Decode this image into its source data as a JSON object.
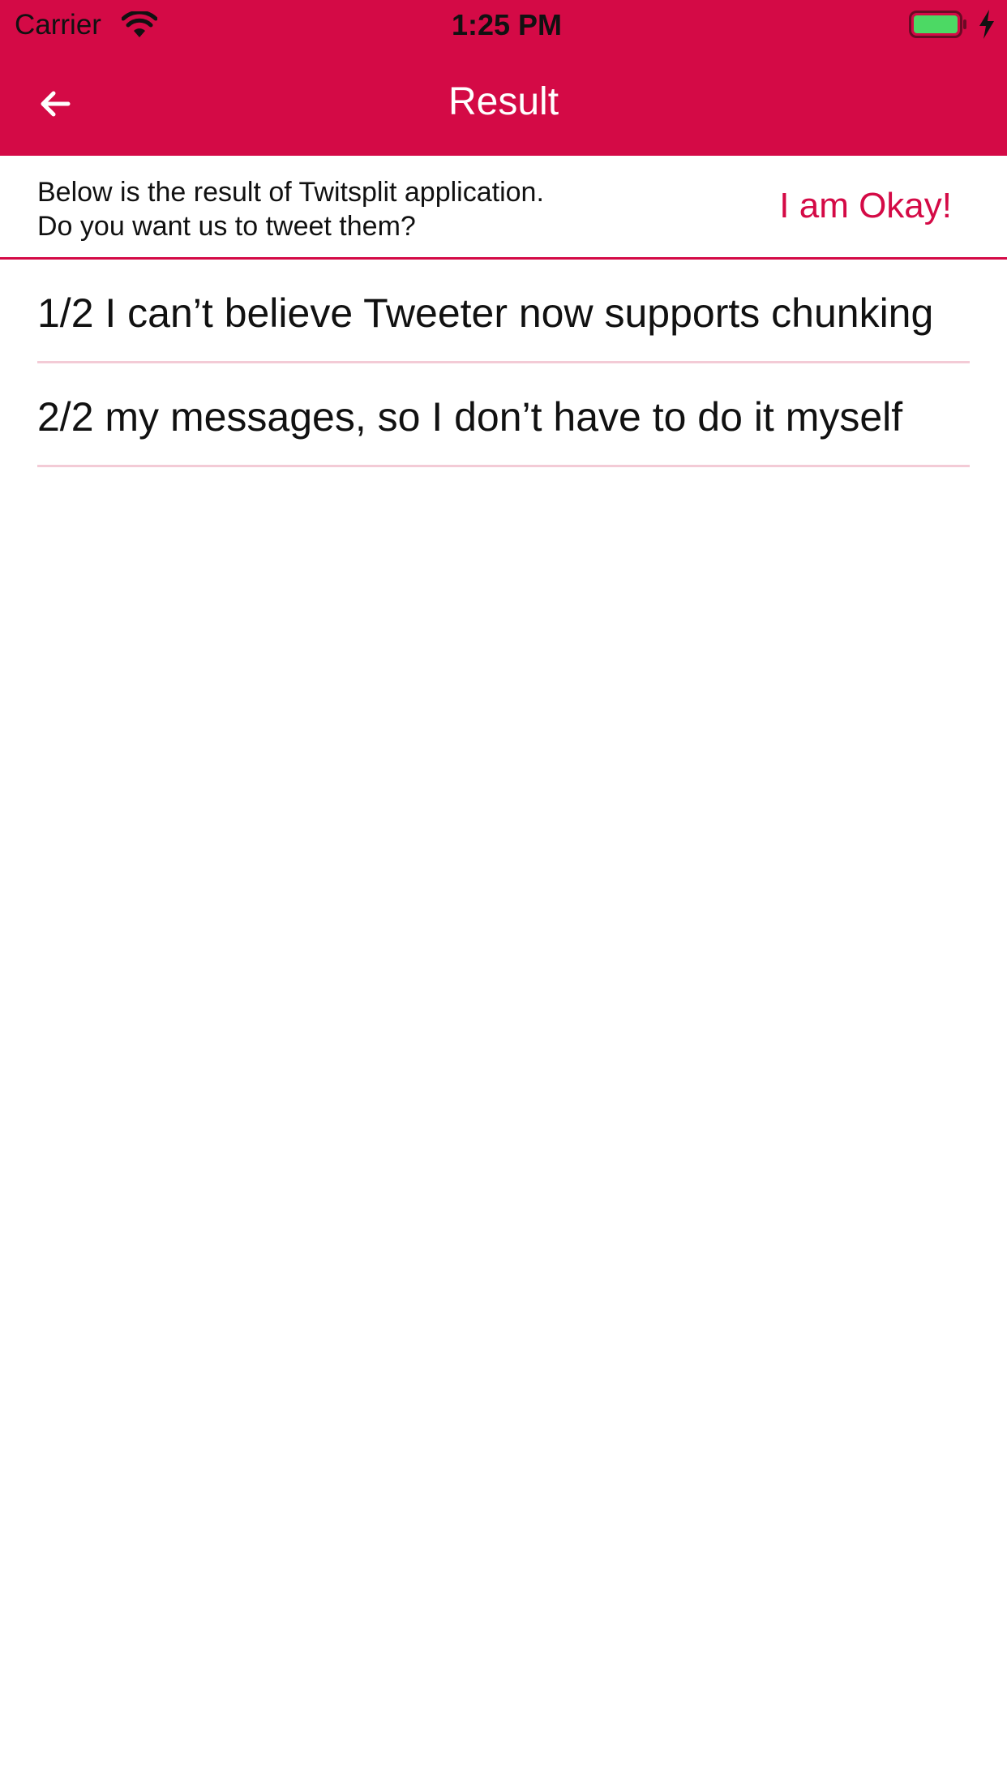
{
  "status_bar": {
    "carrier": "Carrier",
    "time": "1:25 PM",
    "wifi_icon": "wifi-icon",
    "battery_icon": "battery-icon",
    "charging_icon": "bolt-icon"
  },
  "nav": {
    "title": "Result",
    "back_icon": "arrow-left-icon"
  },
  "info": {
    "line1": "Below is the result of Twitsplit application.",
    "line2": "Do you want us to tweet them?",
    "okay_label": "I am Okay!"
  },
  "tweets": [
    "1/2 I can’t believe Tweeter now supports chunking",
    "2/2 my messages, so I don’t have to do it myself"
  ],
  "colors": {
    "accent": "#d40a46",
    "divider": "#f3cbd6",
    "text": "#111111",
    "battery_fill": "#4cd964"
  }
}
